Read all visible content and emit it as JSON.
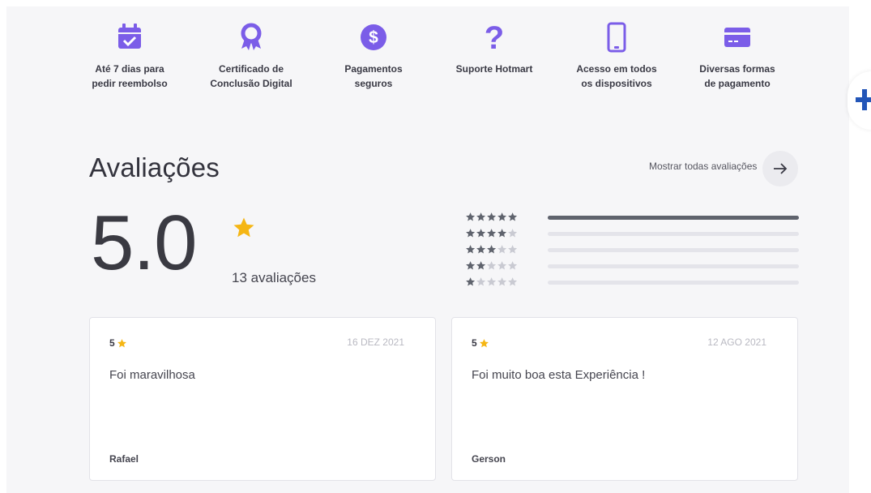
{
  "features": [
    {
      "icon": "calendar-check-icon",
      "label": "Até 7 dias para\npedir reembolso"
    },
    {
      "icon": "award-ribbon-icon",
      "label": "Certificado de\nConclusão Digital"
    },
    {
      "icon": "dollar-coin-icon",
      "label": "Pagamentos\nseguros"
    },
    {
      "icon": "question-mark-icon",
      "label": "Suporte Hotmart"
    },
    {
      "icon": "smartphone-icon",
      "label": "Acesso em todos\nos dispositivos"
    },
    {
      "icon": "credit-card-icon",
      "label": "Diversas formas\nde pagamento"
    }
  ],
  "reviews": {
    "title": "Avaliações",
    "show_all_label": "Mostrar todas avaliações",
    "average": "5.0",
    "count_label": "13 avaliações",
    "distribution": [
      {
        "stars": 5,
        "fraction": 1.0
      },
      {
        "stars": 4,
        "fraction": 0.0
      },
      {
        "stars": 3,
        "fraction": 0.0
      },
      {
        "stars": 2,
        "fraction": 0.0
      },
      {
        "stars": 1,
        "fraction": 0.0
      }
    ],
    "cards": [
      {
        "rating": "5",
        "date": "16 DEZ 2021",
        "text": "Foi maravilhosa",
        "author": "Rafael"
      },
      {
        "rating": "5",
        "date": "12 AGO 2021",
        "text": "Foi muito boa esta Experiência !",
        "author": "Gerson"
      }
    ]
  },
  "colors": {
    "icon_purple": "#7b5de8",
    "star_gold": "#f5b614",
    "bar_fill": "#5f636d",
    "bar_track": "#e4e4ea"
  }
}
